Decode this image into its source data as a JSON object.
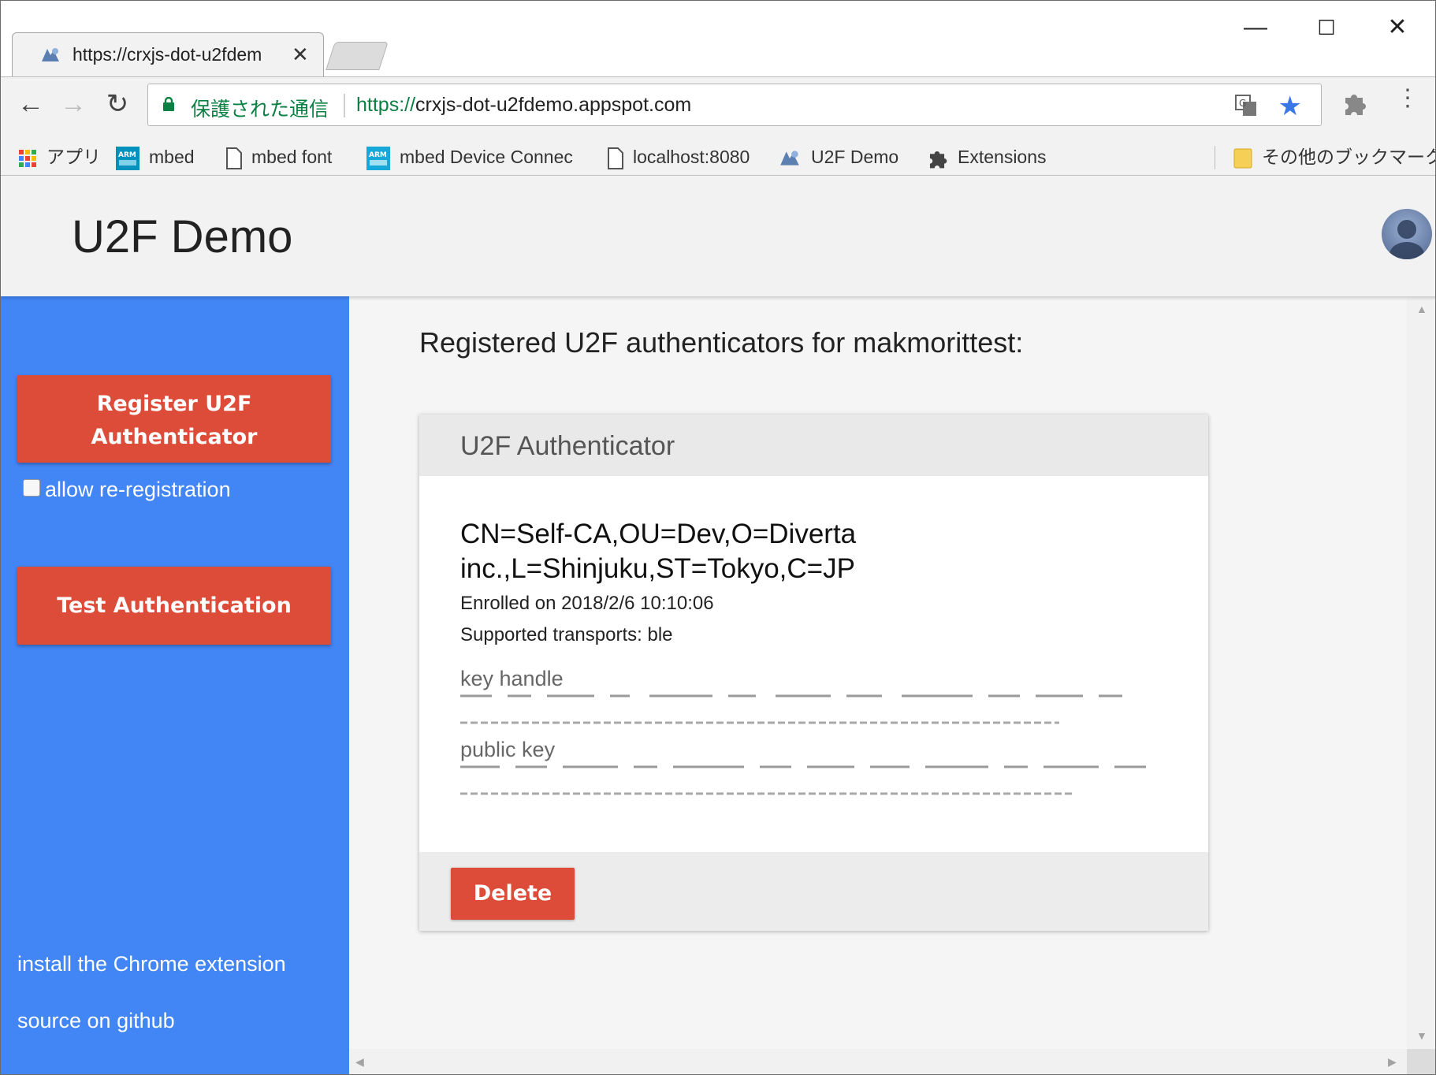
{
  "browser": {
    "tab_title": "https://crxjs-dot-u2fdem",
    "tab_close": "✕",
    "window_controls": {
      "minimize": "—",
      "maximize": "☐",
      "close": "✕"
    },
    "nav": {
      "back": "←",
      "forward": "→",
      "reload": "↻"
    },
    "omnibox": {
      "security_label": "保護された通信",
      "url_scheme": "https://",
      "url_host": "crxjs-dot-u2fdemo.appspot.com"
    },
    "menu": "⋮",
    "bookmarks": [
      {
        "label": "アプリ",
        "icon": "apps-grid-icon"
      },
      {
        "label": "mbed",
        "icon": "arm-mbed-icon"
      },
      {
        "label": "mbed font",
        "icon": "page-icon"
      },
      {
        "label": "mbed Device Connec",
        "icon": "arm-mbed-icon"
      },
      {
        "label": "localhost:8080",
        "icon": "page-icon"
      },
      {
        "label": "U2F Demo",
        "icon": "u2f-favicon-icon"
      },
      {
        "label": "Extensions",
        "icon": "puzzle-icon"
      },
      {
        "label": "その他のブックマーク",
        "icon": "folder-icon"
      }
    ]
  },
  "app": {
    "title": "U2F Demo"
  },
  "sidebar": {
    "register_button": [
      "Register U2F",
      "Authenticator"
    ],
    "allow_reregistration_label": "allow re-registration",
    "allow_reregistration_checked": false,
    "test_button": "Test Authentication",
    "links": [
      "install the Chrome extension",
      "source on github"
    ]
  },
  "main": {
    "heading": "Registered U2F authenticators for makmorittest:",
    "card": {
      "header": "U2F Authenticator",
      "subject_lines": [
        "CN=Self-CA,OU=Dev,O=Diverta",
        "inc.,L=Shinjuku,ST=Tokyo,C=JP"
      ],
      "enrolled": "Enrolled on 2018/2/6 10:10:06",
      "transports": "Supported transports: ble",
      "key_handle_label": "key handle",
      "public_key_label": "public key",
      "delete_button": "Delete"
    }
  },
  "colors": {
    "sidebar_blue": "#4285f4",
    "button_red": "#dd4b39",
    "secure_green": "#0b8043",
    "star_blue": "#3b78e7"
  }
}
